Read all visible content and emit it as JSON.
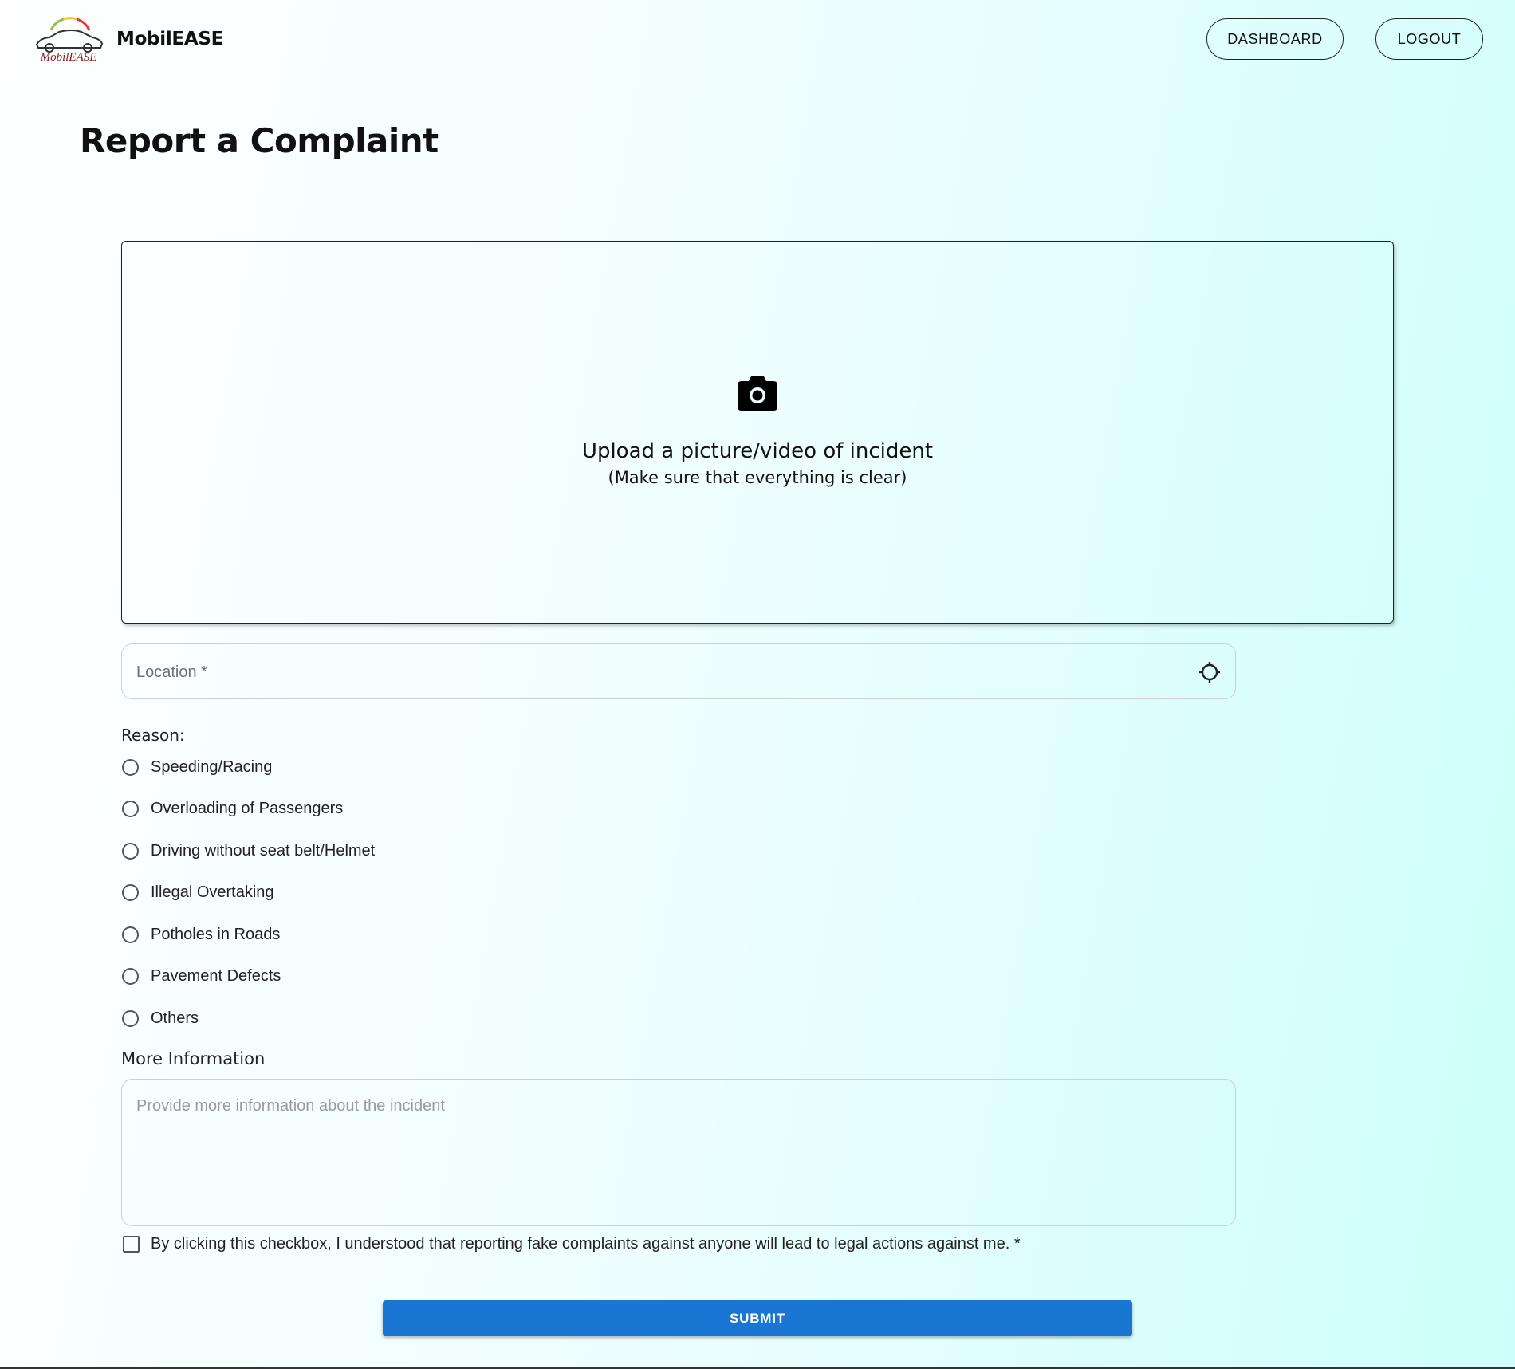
{
  "header": {
    "brand": "MobilEASE",
    "logo_text": "MobilEASE",
    "dashboard_label": "DASHBOARD",
    "logout_label": "LOGOUT"
  },
  "page_title": "Report a Complaint",
  "upload": {
    "icon": "camera-icon",
    "title": "Upload a picture/video of incident",
    "subtitle": "(Make sure that everything is clear)"
  },
  "location": {
    "placeholder": "Location *",
    "value": "",
    "icon": "crosshair-icon"
  },
  "reason": {
    "label": "Reason:",
    "options": [
      "Speeding/Racing",
      "Overloading of Passengers",
      "Driving without seat belt/Helmet",
      "Illegal Overtaking",
      "Potholes in Roads",
      "Pavement Defects",
      "Others"
    ]
  },
  "more_info": {
    "label": "More Information",
    "placeholder": "Provide more information about the incident",
    "value": ""
  },
  "consent": {
    "text": "By clicking this checkbox, I understood that reporting fake complaints against anyone will lead to legal actions against me. *",
    "checked": false
  },
  "submit_label": "SUBMIT",
  "colors": {
    "primary": "#1976d2",
    "background_start": "#ffffff",
    "background_end": "#ccfffb"
  }
}
